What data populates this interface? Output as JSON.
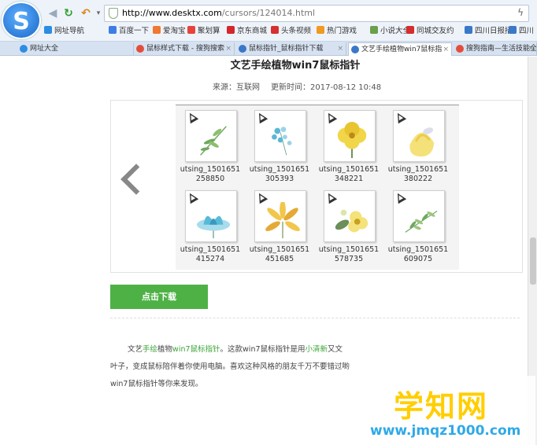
{
  "browser": {
    "url_domain": "http://www.desktx.com",
    "url_path": "/cursors/124014.html",
    "logo_letter": "S",
    "favorites": [
      {
        "label": "网址导航",
        "color": "#2d8de3"
      },
      {
        "label": "百度一下",
        "color": "#3d7de6"
      },
      {
        "label": "爱淘宝",
        "color": "#f07830"
      },
      {
        "label": "聚划算",
        "color": "#e6433c"
      },
      {
        "label": "京东商城",
        "color": "#d4262b"
      },
      {
        "label": "头条视频",
        "color": "#d62f2f"
      },
      {
        "label": "热门游戏",
        "color": "#f09a20"
      },
      {
        "label": "小说大全",
        "color": "#6aa04a"
      },
      {
        "label": "同城交友约",
        "color": "#d62c2c"
      },
      {
        "label": "四川日报招",
        "color": "#3a78c8"
      },
      {
        "label": "四川",
        "color": "#3a78c8"
      }
    ],
    "tabs": [
      {
        "label": "网址大全",
        "color": "#2d8de3"
      },
      {
        "label": "鼠标样式下载 - 搜狗搜索",
        "color": "#e34e3c"
      },
      {
        "label": "鼠标指针_鼠标指针下载",
        "color": "#3a78c8"
      },
      {
        "label": "文艺手绘植物win7鼠标指",
        "color": "#3a78c8"
      },
      {
        "label": "搜狗指南—生活技能全",
        "color": "#e34e3c"
      }
    ]
  },
  "article": {
    "title": "文艺手绘植物win7鼠标指针",
    "source": "来源：互联网",
    "updated": "更新时间：2017-08-12 10:48"
  },
  "gallery": {
    "items": [
      {
        "line1": "utsing_1501651",
        "line2": "258850",
        "plant": "green-sprig",
        "colors": [
          "#6fa860",
          "#8bbf6a"
        ]
      },
      {
        "line1": "utsing_1501651",
        "line2": "305393",
        "plant": "blue-sprig",
        "colors": [
          "#5bb7d4",
          "#9ad3e6"
        ]
      },
      {
        "line1": "utsing_1501651",
        "line2": "348221",
        "plant": "yellow-flower",
        "colors": [
          "#f2d64a",
          "#e8c530"
        ]
      },
      {
        "line1": "utsing_1501651",
        "line2": "380222",
        "plant": "yellow-rose",
        "colors": [
          "#f5e17a",
          "#e9cc4c"
        ]
      },
      {
        "line1": "utsing_1501651",
        "line2": "415274",
        "plant": "blue-lotus",
        "colors": [
          "#58b9d8",
          "#a7dcec"
        ]
      },
      {
        "line1": "utsing_1501651",
        "line2": "451685",
        "plant": "yellow-lily",
        "colors": [
          "#f1c64b",
          "#e5a935"
        ]
      },
      {
        "line1": "utsing_1501651",
        "line2": "578735",
        "plant": "yellow-blossom",
        "colors": [
          "#f4e27a",
          "#6b8e5a"
        ]
      },
      {
        "line1": "utsing_1501651",
        "line2": "609075",
        "plant": "leaf-branch",
        "colors": [
          "#6fa860",
          "#9cc47e"
        ]
      }
    ]
  },
  "download_label": "点击下载",
  "paragraph": {
    "p1a": "文艺",
    "g1": "手绘",
    "p1b": "植物",
    "g2": "win7鼠标指针",
    "p1c": "。这款win7鼠标指针是用",
    "g3": "小清新",
    "p1d": "又文",
    "line2": "叶子，变成鼠标陪伴着你使用电脑。喜欢这种风格的朋友千万不要错过喲",
    "line3": "win7鼠标指针等你来发现。"
  },
  "watermark": {
    "big": "学知网",
    "small": "www.jmqz1000.com"
  }
}
